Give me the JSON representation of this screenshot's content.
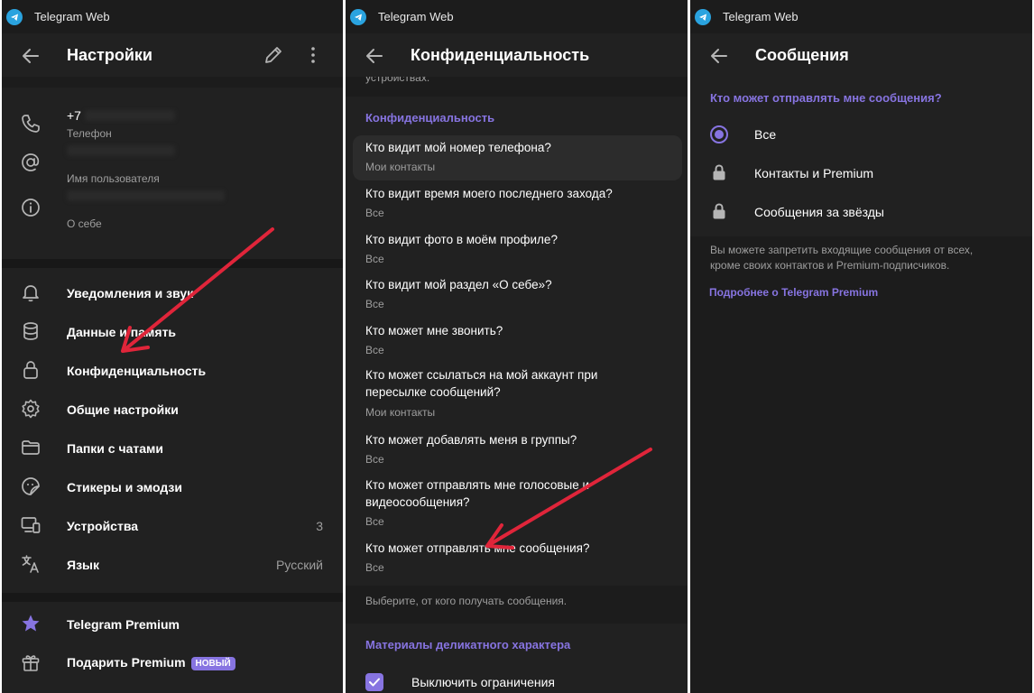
{
  "app_title": "Telegram Web",
  "colors": {
    "accent": "#8774e1",
    "arrow": "#e0253a",
    "panel_bg": "#212121"
  },
  "settings": {
    "title": "Настройки",
    "phone_value": "+7",
    "phone_label": "Телефон",
    "username_label": "Имя пользователя",
    "bio_label": "О себе",
    "menu": [
      {
        "label": "Уведомления и звук",
        "icon": "bell-icon"
      },
      {
        "label": "Данные и память",
        "icon": "database-icon"
      },
      {
        "label": "Конфиденциальность",
        "icon": "lock-icon"
      },
      {
        "label": "Общие настройки",
        "icon": "gear-icon"
      },
      {
        "label": "Папки с чатами",
        "icon": "folder-icon"
      },
      {
        "label": "Стикеры и эмодзи",
        "icon": "sticker-icon"
      },
      {
        "label": "Устройства",
        "icon": "devices-icon",
        "value": "3"
      },
      {
        "label": "Язык",
        "icon": "language-icon",
        "value": "Русский"
      }
    ],
    "premium_label": "Telegram Premium",
    "gift_label": "Подарить Premium",
    "new_badge": "НОВЫЙ"
  },
  "privacy": {
    "title": "Конфиденциальность",
    "top_clip": "устройствах.",
    "section_title": "Конфиденциальность",
    "items": [
      {
        "q": "Кто видит мой номер телефона?",
        "a": "Мои контакты"
      },
      {
        "q": "Кто видит время моего последнего захода?",
        "a": "Все"
      },
      {
        "q": "Кто видит фото в моём профиле?",
        "a": "Все"
      },
      {
        "q": "Кто видит мой раздел «О себе»?",
        "a": "Все"
      },
      {
        "q": "Кто может мне звонить?",
        "a": "Все"
      },
      {
        "q1": "Кто может ссылаться на мой аккаунт при",
        "q2": "пересылке сообщений?",
        "a": "Мои контакты"
      },
      {
        "q": "Кто может добавлять меня в группы?",
        "a": "Все"
      },
      {
        "q1": "Кто может отправлять мне голосовые и",
        "q2": "видеосообщения?",
        "a": "Все"
      },
      {
        "q": "Кто может отправлять мне сообщения?",
        "a": "Все"
      }
    ],
    "hint": "Выберите, от кого получать сообщения.",
    "sensitive_title": "Материалы деликатного характера",
    "disable_restrictions": "Выключить ограничения"
  },
  "messages": {
    "title": "Сообщения",
    "question": "Кто может отправлять мне сообщения?",
    "options": [
      {
        "label": "Все",
        "selected": true
      },
      {
        "label": "Контакты и Premium",
        "locked": true
      },
      {
        "label": "Сообщения за звёзды",
        "locked": true
      }
    ],
    "note_line1": "Вы можете запретить входящие сообщения от всех,",
    "note_line2": "кроме своих контактов и Premium-подписчиков.",
    "link": "Подробнее о Telegram Premium"
  }
}
